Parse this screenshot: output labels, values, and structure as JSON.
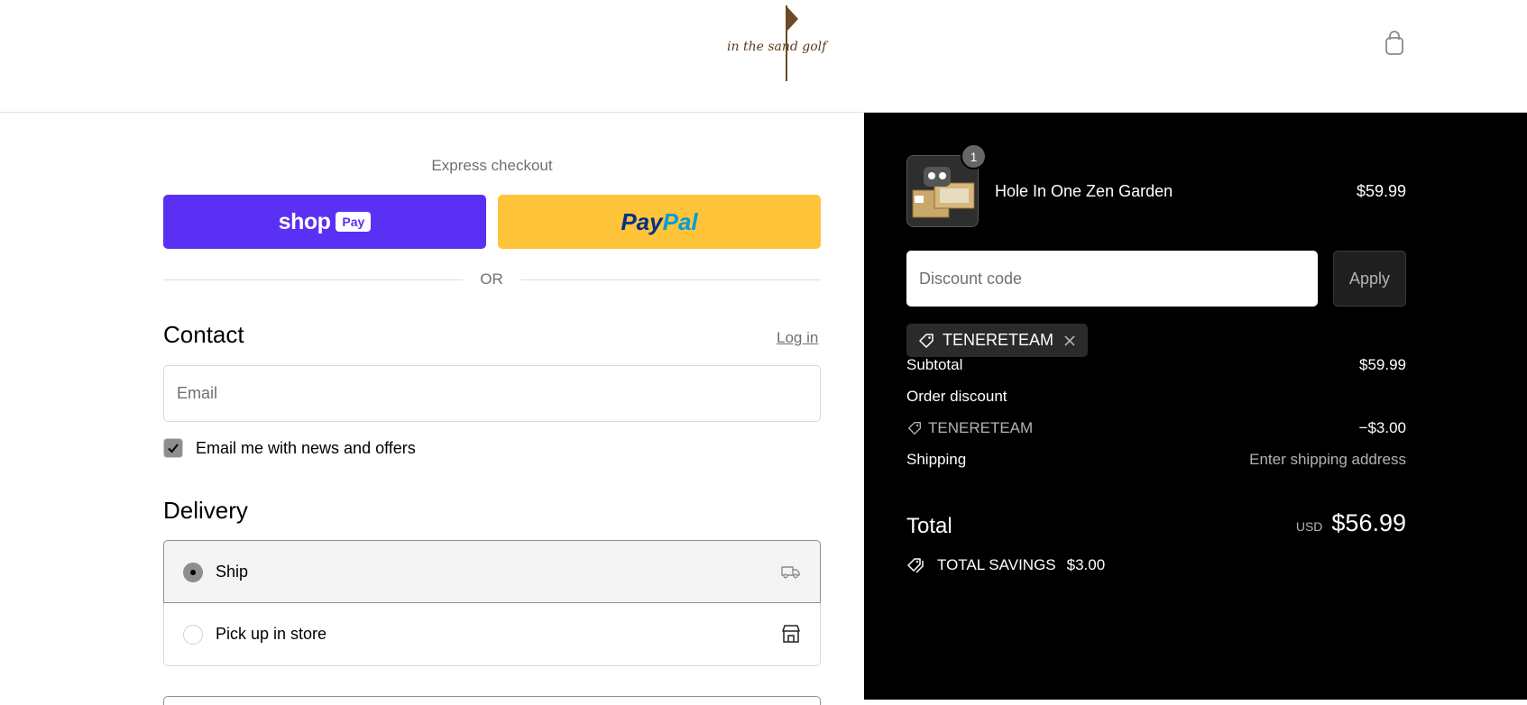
{
  "header": {
    "logo_text": "in the sand golf",
    "cart_icon": "shopping-bag-icon"
  },
  "express": {
    "title": "Express checkout",
    "shop_pay_word": "shop",
    "shop_pay_badge": "Pay",
    "paypal_part1": "Pay",
    "paypal_part2": "Pal",
    "or_label": "OR"
  },
  "contact": {
    "heading": "Contact",
    "login_link": "Log in",
    "email_placeholder": "Email",
    "newsletter_label": "Email me with news and offers",
    "newsletter_checked": true
  },
  "delivery": {
    "heading": "Delivery",
    "options": [
      {
        "label": "Ship",
        "selected": true,
        "icon": "truck-icon"
      },
      {
        "label": "Pick up in store",
        "selected": false,
        "icon": "store-icon"
      }
    ]
  },
  "summary": {
    "item": {
      "name": "Hole In One Zen Garden",
      "price": "$59.99",
      "quantity": "1"
    },
    "discount_placeholder": "Discount code",
    "apply_label": "Apply",
    "applied_code": "TENERETEAM",
    "subtotal_label": "Subtotal",
    "subtotal_value": "$59.99",
    "order_discount_label": "Order discount",
    "discount_code": "TENERETEAM",
    "discount_value": "−$3.00",
    "shipping_label": "Shipping",
    "shipping_value": "Enter shipping address",
    "total_label": "Total",
    "currency": "USD",
    "total_value": "$56.99",
    "savings_label": "TOTAL SAVINGS",
    "savings_value": "$3.00"
  },
  "colors": {
    "shop_pay": "#5a31f4",
    "paypal": "#ffc439",
    "summary_bg": "#000000"
  }
}
